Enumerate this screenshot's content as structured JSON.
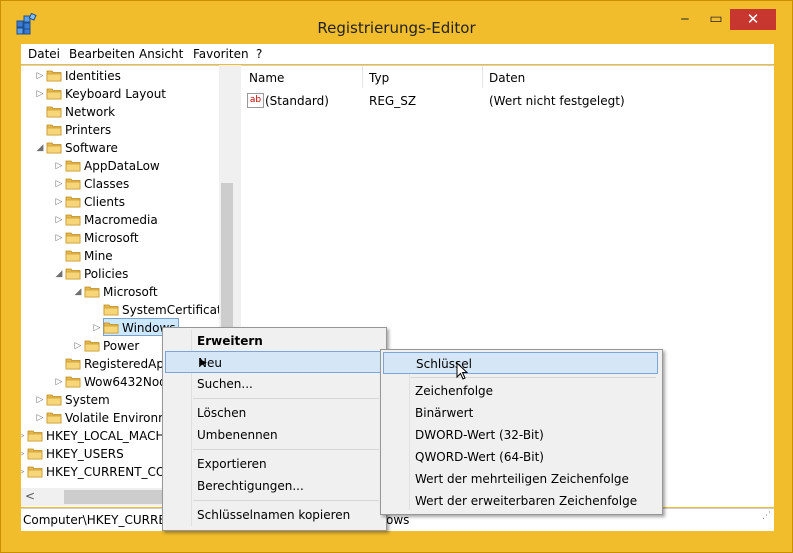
{
  "window": {
    "title": "Registrierungs-Editor",
    "controls": {
      "minimize": "‒",
      "maximize": "▭",
      "close": "✕"
    }
  },
  "menubar": [
    "Datei",
    "Bearbeiten",
    "Ansicht",
    "Favoriten",
    "?"
  ],
  "tree": [
    {
      "label": "Identities",
      "expand": "▷"
    },
    {
      "label": "Keyboard Layout",
      "expand": "▷"
    },
    {
      "label": "Network",
      "expand": ""
    },
    {
      "label": "Printers",
      "expand": ""
    },
    {
      "label": "Software",
      "expand": "◢"
    },
    {
      "label": "AppDataLow",
      "expand": "▷"
    },
    {
      "label": "Classes",
      "expand": "▷"
    },
    {
      "label": "Clients",
      "expand": "▷"
    },
    {
      "label": "Macromedia",
      "expand": "▷"
    },
    {
      "label": "Microsoft",
      "expand": "▷"
    },
    {
      "label": "Mine",
      "expand": ""
    },
    {
      "label": "Policies",
      "expand": "◢"
    },
    {
      "label": "Microsoft",
      "expand": "◢"
    },
    {
      "label": "SystemCertificate",
      "expand": ""
    },
    {
      "label": "Windows",
      "expand": "▷"
    },
    {
      "label": "Power",
      "expand": "▷"
    },
    {
      "label": "RegisteredApp",
      "expand": ""
    },
    {
      "label": "Wow6432Nod",
      "expand": "▷"
    },
    {
      "label": "System",
      "expand": "▷"
    },
    {
      "label": "Volatile Environm",
      "expand": "▷"
    },
    {
      "label": "HKEY_LOCAL_MACH",
      "expand": "▷"
    },
    {
      "label": "HKEY_USERS",
      "expand": "▷"
    },
    {
      "label": "HKEY_CURRENT_CON",
      "expand": "▷"
    }
  ],
  "list": {
    "columns": [
      "Name",
      "Typ",
      "Daten"
    ],
    "rows": [
      {
        "icon": "ab",
        "name": "(Standard)",
        "type": "REG_SZ",
        "data": "(Wert nicht festgelegt)"
      }
    ]
  },
  "status": {
    "path": "Computer\\HKEY_CURRENT",
    "tail": "ows"
  },
  "context_menu": {
    "items": [
      "Erweitern",
      "Neu",
      "Suchen...",
      "Löschen",
      "Umbenennen",
      "Exportieren",
      "Berechtigungen...",
      "Schlüsselnamen kopieren"
    ],
    "submenu_arrow": "▶"
  },
  "submenu": {
    "items": [
      "Schlüssel",
      "Zeichenfolge",
      "Binärwert",
      "DWORD-Wert (32-Bit)",
      "QWORD-Wert (64-Bit)",
      "Wert der mehrteiligen Zeichenfolge",
      "Wert der erweiterbaren Zeichenfolge"
    ]
  },
  "colors": {
    "frame": "#f1bd2d",
    "close": "#c7372f",
    "highlight": "#d5e6f7",
    "selection": "#cce8ff"
  }
}
